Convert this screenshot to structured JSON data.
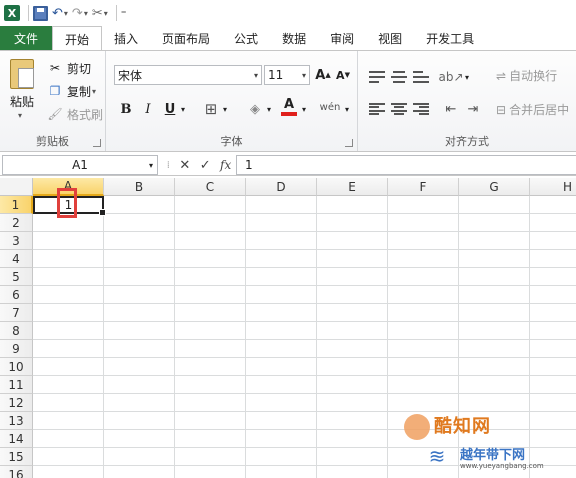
{
  "qat": {
    "dropdown_glyph": "▾",
    "customize_glyph": "⁼"
  },
  "tabs": [
    "文件",
    "开始",
    "插入",
    "页面布局",
    "公式",
    "数据",
    "审阅",
    "视图",
    "开发工具"
  ],
  "clipboard": {
    "paste_label": "粘贴",
    "cut_label": "剪切",
    "copy_label": "复制",
    "format_painter_label": "格式刷",
    "group_label": "剪贴板"
  },
  "font": {
    "name": "宋体",
    "size": "11",
    "bold": "B",
    "italic": "I",
    "underline": "U",
    "font_color_letter": "A",
    "phonetic": "wén",
    "group_label": "字体"
  },
  "alignment": {
    "wrap_text_label": "自动换行",
    "merge_center_label": "合并后居中",
    "group_label": "对齐方式"
  },
  "formula_bar": {
    "name_box": "A1",
    "fx": "fx",
    "content": "1"
  },
  "grid": {
    "columns": [
      "A",
      "B",
      "C",
      "D",
      "E",
      "F",
      "G",
      "H"
    ],
    "rows": [
      "1",
      "2",
      "3",
      "4",
      "5",
      "6",
      "7",
      "8",
      "9",
      "10",
      "11",
      "12",
      "13",
      "14",
      "15",
      "16"
    ],
    "active_cell_value": "1"
  },
  "watermark": {
    "brand": "酷知网",
    "site_name": "越年带下网",
    "url": "www.yueyangbang.com"
  },
  "colors": {
    "file_tab": "#2a7d3e",
    "selected_header": "#f9d36b",
    "highlight": "#e0403c",
    "font_color_bar": "#e0201c"
  }
}
